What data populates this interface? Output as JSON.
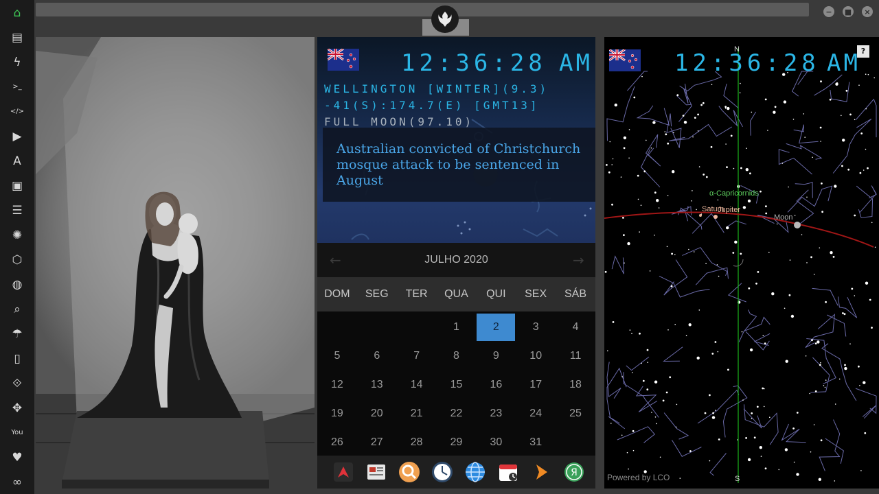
{
  "sidebar": {
    "items": [
      {
        "name": "home-icon",
        "glyph": "⌂"
      },
      {
        "name": "document-icon",
        "glyph": "▤"
      },
      {
        "name": "lightning-icon",
        "glyph": "ϟ"
      },
      {
        "name": "terminal-icon",
        "glyph": ">_"
      },
      {
        "name": "code-icon",
        "glyph": "</>"
      },
      {
        "name": "play-icon",
        "glyph": "▶"
      },
      {
        "name": "translate-icon",
        "glyph": "A"
      },
      {
        "name": "image-icon",
        "glyph": "▣"
      },
      {
        "name": "news-icon",
        "glyph": "☰"
      },
      {
        "name": "rebel-icon",
        "glyph": "✺"
      },
      {
        "name": "network-icon",
        "glyph": "⬡"
      },
      {
        "name": "globe-icon",
        "glyph": "◍"
      },
      {
        "name": "search-icon",
        "glyph": "⌕"
      },
      {
        "name": "umbrella-icon",
        "glyph": "☂"
      },
      {
        "name": "contacts-icon",
        "glyph": "▯"
      },
      {
        "name": "link-icon",
        "glyph": "⟐"
      },
      {
        "name": "expand-icon",
        "glyph": "✥"
      },
      {
        "name": "youtube-icon",
        "glyph": "You"
      },
      {
        "name": "heart-icon",
        "glyph": "♥"
      },
      {
        "name": "infinity-icon",
        "glyph": "∞"
      }
    ],
    "active_color": "#3fcb57"
  },
  "clock": {
    "time": "12:36:28",
    "ampm": "AM",
    "location_line": "WELLINGTON [WINTER](9.3)",
    "coords_line": "-41(S):174.7(E) [GMT13]",
    "moon_line": "FULL MOON(97.10)"
  },
  "news": {
    "headline": "Australian convicted of Christchurch mosque attack to be sentenced in August"
  },
  "calendar": {
    "month_label": "JULHO 2020",
    "prev": "←",
    "next": "→",
    "weekdays": [
      "DOM",
      "SEG",
      "TER",
      "QUA",
      "QUI",
      "SEX",
      "SÁB"
    ],
    "first_weekday_index": 3,
    "days_in_month": 31,
    "today": 2,
    "today_color": "#3e8ad0"
  },
  "dock": {
    "apps": [
      "app-launcher-icon",
      "news-reader-icon",
      "search-app-icon",
      "clock-app-icon",
      "browser-globe-icon",
      "calendar-app-icon",
      "next-arrow-icon",
      "yandex-icon"
    ]
  },
  "sky": {
    "north_label": "N",
    "south_label": "S",
    "help": "?",
    "powered_by": "Powered by LCO",
    "labels": {
      "meteor_shower": "α-Capricornids",
      "saturn": "Saturn",
      "jupiter": "Jupiter",
      "moon": "Moon"
    }
  },
  "window": {
    "minimize": "−",
    "maximize": "■",
    "close": "×"
  }
}
